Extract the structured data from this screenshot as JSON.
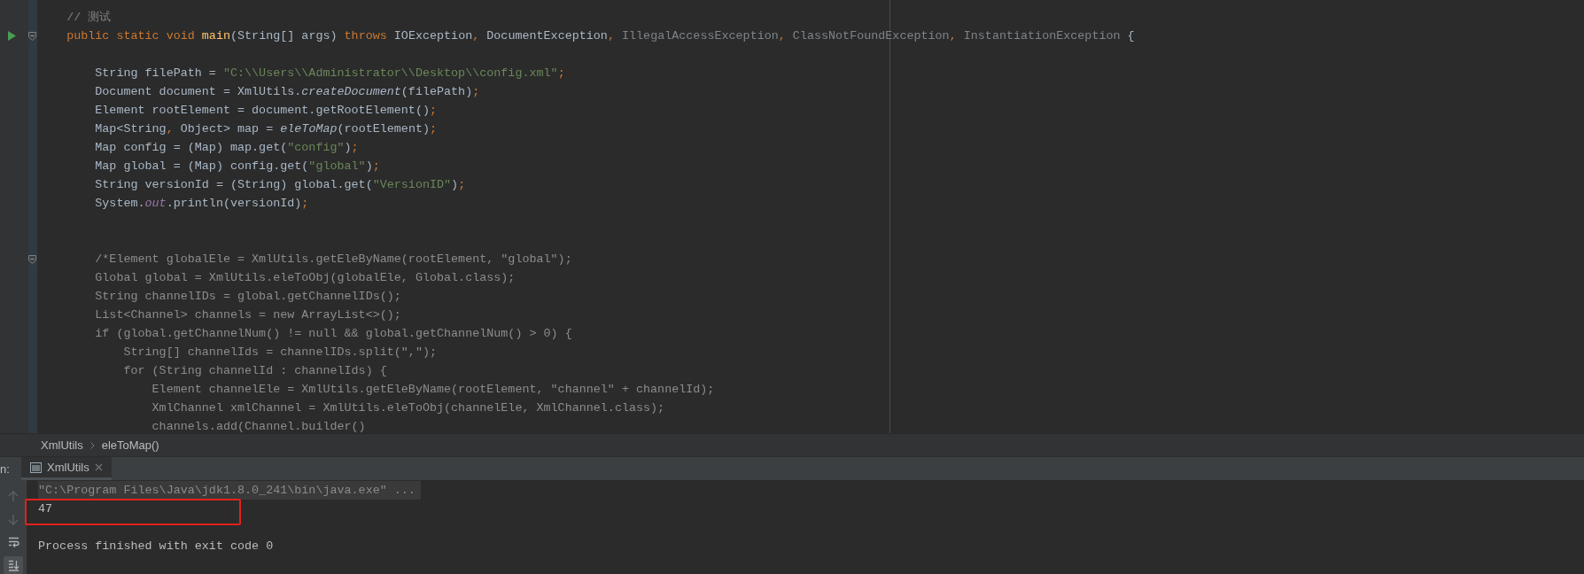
{
  "editor": {
    "lines": [
      {
        "kind": "code",
        "run": false,
        "fold": false,
        "tokens": [
          {
            "kind": "comment",
            "text": "    // 测试"
          }
        ]
      },
      {
        "kind": "code",
        "run": true,
        "fold": true,
        "tokens": [
          {
            "kind": "keyword",
            "text": "    public static void "
          },
          {
            "kind": "method",
            "text": "main"
          },
          {
            "kind": "plain",
            "text": "(String[] args) "
          },
          {
            "kind": "keyword",
            "text": "throws "
          },
          {
            "kind": "plain",
            "text": "IOException"
          },
          {
            "kind": "punct",
            "text": ", "
          },
          {
            "kind": "plain",
            "text": "DocumentException"
          },
          {
            "kind": "punct",
            "text": ", "
          },
          {
            "kind": "unused",
            "text": "IllegalAccessException"
          },
          {
            "kind": "punct",
            "text": ", "
          },
          {
            "kind": "unused",
            "text": "ClassNotFoundException"
          },
          {
            "kind": "punct",
            "text": ", "
          },
          {
            "kind": "unused",
            "text": "InstantiationException"
          },
          {
            "kind": "plain",
            "text": " {"
          }
        ]
      },
      {
        "kind": "blank"
      },
      {
        "kind": "code",
        "run": false,
        "fold": false,
        "tokens": [
          {
            "kind": "plain",
            "text": "        String filePath = "
          },
          {
            "kind": "string",
            "text": "\"C:\\\\Users\\\\Administrator\\\\Desktop\\\\config.xml\""
          },
          {
            "kind": "punct",
            "text": ";"
          }
        ]
      },
      {
        "kind": "code",
        "run": false,
        "fold": false,
        "tokens": [
          {
            "kind": "plain",
            "text": "        Document document = XmlUtils."
          },
          {
            "kind": "static",
            "text": "createDocument"
          },
          {
            "kind": "plain",
            "text": "(filePath)"
          },
          {
            "kind": "punct",
            "text": ";"
          }
        ]
      },
      {
        "kind": "code",
        "run": false,
        "fold": false,
        "tokens": [
          {
            "kind": "plain",
            "text": "        Element rootElement = document.getRootElement()"
          },
          {
            "kind": "punct",
            "text": ";"
          }
        ]
      },
      {
        "kind": "code",
        "run": false,
        "fold": false,
        "tokens": [
          {
            "kind": "plain",
            "text": "        Map<String"
          },
          {
            "kind": "punct",
            "text": ", "
          },
          {
            "kind": "plain",
            "text": "Object> map = "
          },
          {
            "kind": "static",
            "text": "eleToMap"
          },
          {
            "kind": "plain",
            "text": "(rootElement)"
          },
          {
            "kind": "punct",
            "text": ";"
          }
        ]
      },
      {
        "kind": "code",
        "run": false,
        "fold": false,
        "tokens": [
          {
            "kind": "plain",
            "text": "        Map config = (Map) map.get("
          },
          {
            "kind": "string",
            "text": "\"config\""
          },
          {
            "kind": "plain",
            "text": ")"
          },
          {
            "kind": "punct",
            "text": ";"
          }
        ]
      },
      {
        "kind": "code",
        "run": false,
        "fold": false,
        "tokens": [
          {
            "kind": "plain",
            "text": "        Map global = (Map) config.get("
          },
          {
            "kind": "string",
            "text": "\"global\""
          },
          {
            "kind": "plain",
            "text": ")"
          },
          {
            "kind": "punct",
            "text": ";"
          }
        ]
      },
      {
        "kind": "code",
        "run": false,
        "fold": false,
        "tokens": [
          {
            "kind": "plain",
            "text": "        String versionId = (String) global.get("
          },
          {
            "kind": "string",
            "text": "\"VersionID\""
          },
          {
            "kind": "plain",
            "text": ")"
          },
          {
            "kind": "punct",
            "text": ";"
          }
        ]
      },
      {
        "kind": "code",
        "run": false,
        "fold": false,
        "tokens": [
          {
            "kind": "plain",
            "text": "        System."
          },
          {
            "kind": "field",
            "text": "out"
          },
          {
            "kind": "plain",
            "text": ".println(versionId)"
          },
          {
            "kind": "punct",
            "text": ";"
          }
        ]
      },
      {
        "kind": "blank"
      },
      {
        "kind": "blank"
      },
      {
        "kind": "code",
        "run": false,
        "fold": true,
        "tokens": [
          {
            "kind": "block_comment",
            "text": "        /*Element globalEle = XmlUtils.getEleByName(rootElement, \"global\");"
          }
        ]
      },
      {
        "kind": "code",
        "run": false,
        "fold": false,
        "tokens": [
          {
            "kind": "block_comment",
            "text": "        Global global = XmlUtils.eleToObj(globalEle, Global.class);"
          }
        ]
      },
      {
        "kind": "code",
        "run": false,
        "fold": false,
        "tokens": [
          {
            "kind": "block_comment",
            "text": "        String channelIDs = global.getChannelIDs();"
          }
        ]
      },
      {
        "kind": "code",
        "run": false,
        "fold": false,
        "tokens": [
          {
            "kind": "block_comment",
            "text": "        List<Channel> channels = new ArrayList<>();"
          }
        ]
      },
      {
        "kind": "code",
        "run": false,
        "fold": false,
        "tokens": [
          {
            "kind": "block_comment",
            "text": "        if (global.getChannelNum() != null && global.getChannelNum() > 0) {"
          }
        ]
      },
      {
        "kind": "code",
        "run": false,
        "fold": false,
        "tokens": [
          {
            "kind": "block_comment",
            "text": "            String[] channelIds = channelIDs.split(\",\");"
          }
        ]
      },
      {
        "kind": "code",
        "run": false,
        "fold": false,
        "tokens": [
          {
            "kind": "block_comment",
            "text": "            for (String channelId : channelIds) {"
          }
        ]
      },
      {
        "kind": "code",
        "run": false,
        "fold": false,
        "tokens": [
          {
            "kind": "block_comment",
            "text": "                Element channelEle = XmlUtils.getEleByName(rootElement, \"channel\" + channelId);"
          }
        ]
      },
      {
        "kind": "code",
        "run": false,
        "fold": false,
        "tokens": [
          {
            "kind": "block_comment",
            "text": "                XmlChannel xmlChannel = XmlUtils.eleToObj(channelEle, XmlChannel.class);"
          }
        ]
      },
      {
        "kind": "code",
        "run": false,
        "fold": false,
        "tokens": [
          {
            "kind": "block_comment",
            "text": "                channels.add(Channel.builder()"
          }
        ]
      }
    ]
  },
  "breadcrumb": [
    "XmlUtils",
    "eleToMap()"
  ],
  "run_panel": {
    "label": "n:",
    "tabs": [
      {
        "label": "XmlUtils",
        "selected": true
      }
    ],
    "toolbar": [
      {
        "kind": "up",
        "disabled": true,
        "on": false
      },
      {
        "kind": "down",
        "disabled": true,
        "on": false
      },
      {
        "kind": "wrap",
        "disabled": false,
        "on": false
      },
      {
        "kind": "scroll_end",
        "disabled": false,
        "on": true
      }
    ],
    "console": [
      {
        "kind": "command",
        "text": "\"C:\\Program Files\\Java\\jdk1.8.0_241\\bin\\java.exe\" ..."
      },
      {
        "kind": "output",
        "text": "47"
      },
      {
        "kind": "exit",
        "text": "Process finished with exit code 0"
      }
    ]
  }
}
